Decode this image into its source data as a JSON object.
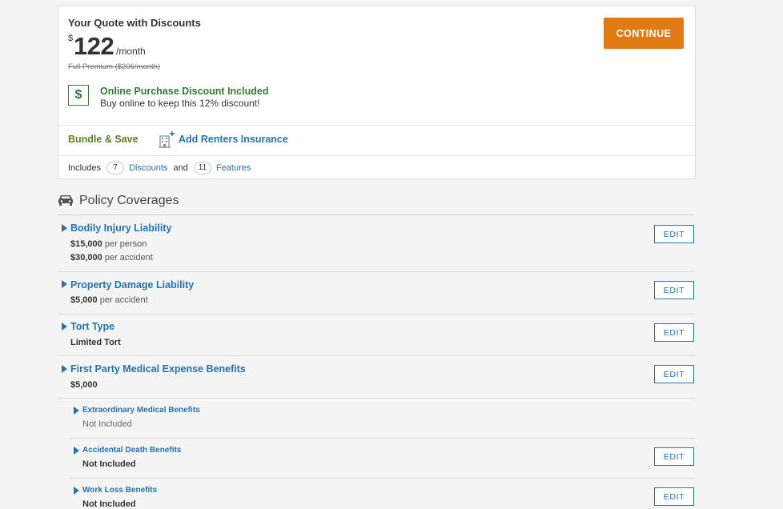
{
  "quote": {
    "title": "Your Quote with Discounts",
    "currency": "$",
    "amount": "122",
    "period": "/month",
    "full_premium": "Full Premium ($206/month)",
    "continue_label": "CONTINUE"
  },
  "discount": {
    "icon": "dollar-icon",
    "symbol": "$",
    "title": "Online Purchase Discount Included",
    "subtitle": "Buy online to keep this 12% discount!"
  },
  "bundle": {
    "label": "Bundle & Save",
    "renters_icon": "building-plus-icon",
    "renters_link": "Add Renters Insurance"
  },
  "includes": {
    "prefix": "Includes",
    "discounts_count": "7",
    "discounts_label": "Discounts",
    "and": "and",
    "features_count": "11",
    "features_label": "Features"
  },
  "coverages": {
    "icon": "car-icon",
    "title": "Policy Coverages",
    "edit_label": "EDIT",
    "items": [
      {
        "name": "Bodily Injury Liability",
        "lines": [
          {
            "amount": "$15,000",
            "unit": "per person"
          },
          {
            "amount": "$30,000",
            "unit": "per accident"
          }
        ]
      },
      {
        "name": "Property Damage Liability",
        "lines": [
          {
            "amount": "$5,000",
            "unit": "per accident"
          }
        ]
      },
      {
        "name": "Tort Type",
        "value": "Limited Tort"
      },
      {
        "name": "First Party Medical Expense Benefits",
        "value": "$5,000"
      },
      {
        "name": "Extraordinary Medical Benefits",
        "value": "Not Included"
      },
      {
        "name": "Accidental Death Benefits",
        "value": "Not Included"
      },
      {
        "name": "Work Loss Benefits",
        "value": "Not Included"
      }
    ]
  },
  "colors": {
    "accent": "#2572b4",
    "continue": "#e07a12",
    "discount_green": "#2e7d32",
    "bundle_green": "#5b7f1f"
  }
}
